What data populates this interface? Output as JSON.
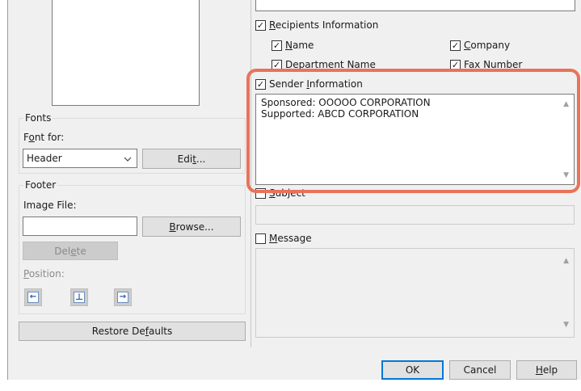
{
  "preview": {},
  "fonts": {
    "group_title": "Fonts",
    "font_for_label": "Font for:",
    "font_for_value": "Header",
    "edit_button": "Edit..."
  },
  "footer": {
    "group_title": "Footer",
    "image_file_label": "Image File:",
    "image_file_value": "",
    "browse_button": "Browse...",
    "delete_button": "Delete",
    "position_label": "Position:",
    "positions": [
      "left",
      "center",
      "right"
    ]
  },
  "restore_defaults_button": "Restore Defaults",
  "recipients": {
    "label": "Recipients Information",
    "checked": true,
    "items": [
      {
        "label": "Name",
        "checked": true
      },
      {
        "label": "Company",
        "checked": true
      },
      {
        "label": "Department Name",
        "checked": true
      },
      {
        "label": "Fax Number",
        "checked": true
      }
    ]
  },
  "sender": {
    "label": "Sender Information",
    "checked": true,
    "lines": [
      "Sponsored: OOOOO CORPORATION",
      "Supported: ABCD CORPORATION"
    ]
  },
  "subject": {
    "label": "Subject",
    "checked": false,
    "value": ""
  },
  "message": {
    "label": "Message",
    "checked": false,
    "value": ""
  },
  "footer_buttons": {
    "ok": "OK",
    "cancel": "Cancel",
    "help": "Help"
  },
  "colors": {
    "highlight": "#e8735a",
    "dialog_bg": "#f0f0f0",
    "default_button_border": "#0078d7"
  }
}
